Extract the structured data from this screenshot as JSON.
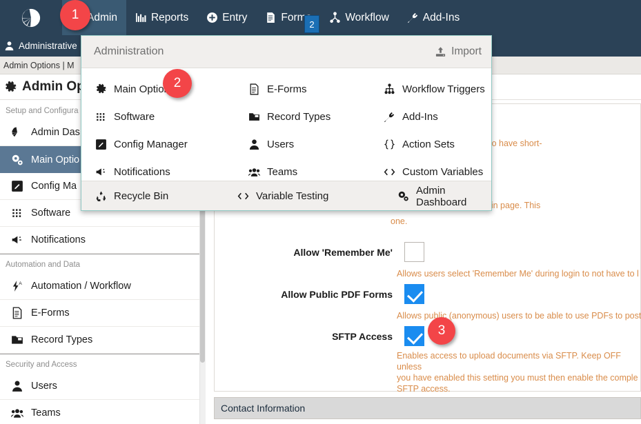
{
  "topnav": {
    "logo_icon": "shell-logo-icon",
    "items": [
      {
        "label": "Admin",
        "icon": "gear-icon",
        "active": true
      },
      {
        "label": "Reports",
        "icon": "bar-chart-icon",
        "active": false
      },
      {
        "label": "Entry",
        "icon": "plus-circle-icon",
        "active": false
      },
      {
        "label": "Forms",
        "icon": "document-icon",
        "active": false
      },
      {
        "label": "Workflow",
        "icon": "workflow-icon",
        "active": false
      },
      {
        "label": "Add-Ins",
        "icon": "plug-icon",
        "active": false
      }
    ]
  },
  "subbar": {
    "label": "Administrative",
    "icon": "user-icon"
  },
  "breadcrumb": {
    "text": "Admin Options | M"
  },
  "page_title": {
    "text": "Admin Optio",
    "icon": "gear-icon"
  },
  "sidebar": {
    "groups": [
      {
        "label": "Setup and Configura",
        "items": [
          {
            "label": "Admin Das",
            "icon": "shell-logo-icon",
            "selected": false
          },
          {
            "label": "Main Optio",
            "icon": "gears-icon",
            "selected": true
          },
          {
            "label": "Config Ma",
            "icon": "pencil-square-icon",
            "selected": false
          },
          {
            "label": "Software",
            "icon": "grid-dots-icon",
            "selected": false
          },
          {
            "label": "Notifications",
            "icon": "megaphone-icon",
            "selected": false
          }
        ]
      },
      {
        "label": "Automation and Data",
        "items": [
          {
            "label": "Automation / Workflow",
            "icon": "bolt-a-icon",
            "selected": false
          },
          {
            "label": "E-Forms",
            "icon": "document-icon",
            "selected": false
          },
          {
            "label": "Record Types",
            "icon": "folder-icon",
            "selected": false
          }
        ]
      },
      {
        "label": "Security and Access",
        "items": [
          {
            "label": "Users",
            "icon": "user-icon",
            "selected": false
          },
          {
            "label": "Teams",
            "icon": "users-group-icon",
            "selected": false
          }
        ]
      }
    ]
  },
  "dropdown": {
    "title": "Administration",
    "import_label": "Import",
    "import_icon": "upload-icon",
    "items": [
      {
        "label": "Main Options",
        "icon": "gear-icon"
      },
      {
        "label": "E-Forms",
        "icon": "document-icon"
      },
      {
        "label": "Workflow Triggers",
        "icon": "sitemap-icon"
      },
      {
        "label": "Software",
        "icon": "grid-dots-icon"
      },
      {
        "label": "Record Types",
        "icon": "folder-icon"
      },
      {
        "label": "Add-Ins",
        "icon": "plug-icon"
      },
      {
        "label": "Config Manager",
        "icon": "pencil-square-icon"
      },
      {
        "label": "Users",
        "icon": "user-icon"
      },
      {
        "label": "Action Sets",
        "icon": "braces-icon"
      },
      {
        "label": "Notifications",
        "icon": "megaphone-icon"
      },
      {
        "label": "Teams",
        "icon": "users-group-icon"
      },
      {
        "label": "Custom Variables",
        "icon": "code-icon"
      }
    ],
    "footer_items": [
      {
        "label": "Recycle Bin",
        "icon": "recycle-icon"
      },
      {
        "label": "Variable Testing",
        "icon": "code-icon"
      },
      {
        "label": "Admin Dashboard",
        "icon": "gears-icon"
      }
    ]
  },
  "main": {
    "partial_hints": [
      "support representatives to have short-",
      "r passwords from the login page. This",
      "one."
    ],
    "fields": [
      {
        "label": "Allow 'Remember Me'",
        "checked": false,
        "help": "Allows users select 'Remember Me' during login to not have to l"
      },
      {
        "label": "Allow Public PDF Forms",
        "checked": true,
        "help": "Allows public (anonymous) users to be able to use PDFs to post"
      },
      {
        "label": "SFTP Access",
        "checked": true,
        "help": "Enables access to upload documents via SFTP. Keep OFF unless\nyou have enabled this setting you must then enable the comple\nSFTP access."
      }
    ],
    "section_header": "Contact Information"
  },
  "badges": [
    {
      "text": "1",
      "shape": "circle"
    },
    {
      "text": "2",
      "shape": "square"
    },
    {
      "text": "2",
      "shape": "circle"
    },
    {
      "text": "3",
      "shape": "circle"
    }
  ],
  "colors": {
    "navbar": "#2b4257",
    "nav_active": "#3a5a73",
    "sidebar_selected": "#5b7894",
    "checkbox_on": "#1a8cf0",
    "help_text": "#d98c4a",
    "badge_red": "#f34548",
    "badge_blue": "#1b6fb5",
    "dropdown_border": "#8fc7c2"
  }
}
